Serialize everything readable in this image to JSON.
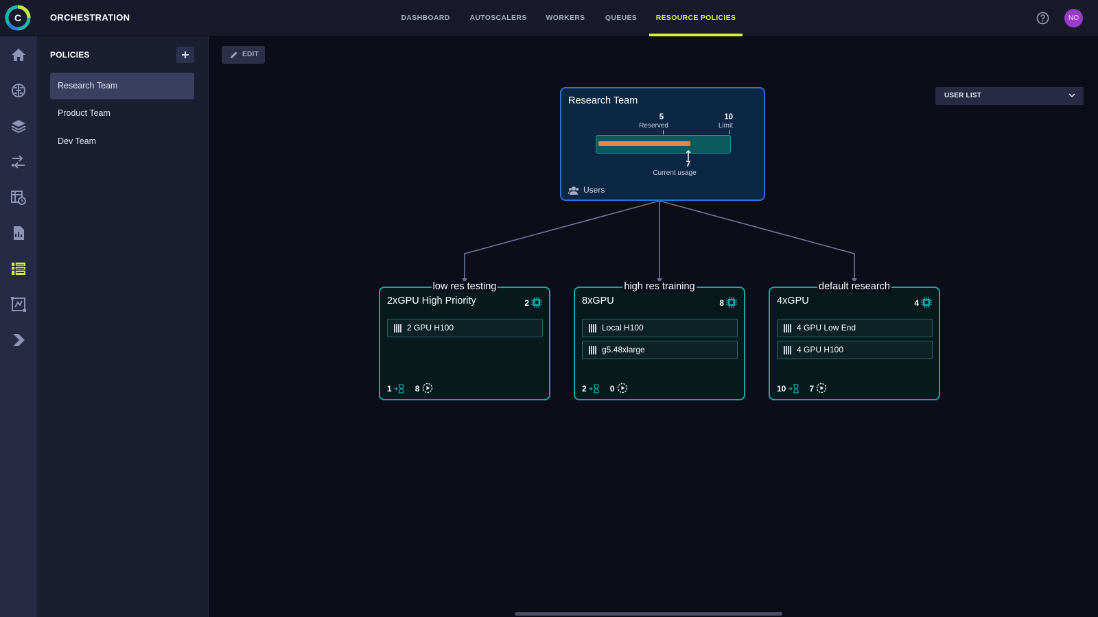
{
  "app": {
    "title": "ORCHESTRATION",
    "user_initials": "NO"
  },
  "nav": {
    "tabs": [
      {
        "label": "DASHBOARD",
        "active": false
      },
      {
        "label": "AUTOSCALERS",
        "active": false
      },
      {
        "label": "WORKERS",
        "active": false
      },
      {
        "label": "QUEUES",
        "active": false
      },
      {
        "label": "RESOURCE POLICIES",
        "active": true
      }
    ]
  },
  "rail": {
    "icons": [
      "home-icon",
      "brain-icon",
      "layers-icon",
      "pipelines-icon",
      "scheduler-icon",
      "reports-icon",
      "orchestration-icon",
      "datasets-icon",
      "deploy-icon"
    ],
    "active": "orchestration-icon"
  },
  "sidebar": {
    "title": "POLICIES",
    "items": [
      {
        "label": "Research Team",
        "selected": true
      },
      {
        "label": "Product Team",
        "selected": false
      },
      {
        "label": "Dev Team",
        "selected": false
      }
    ]
  },
  "toolbar": {
    "edit_label": "EDIT",
    "user_list_label": "USER LIST"
  },
  "root": {
    "name": "Research Team",
    "reserved_value": "5",
    "reserved_label": "Reserved",
    "limit_value": "10",
    "limit_label": "Limit",
    "current_value": "7",
    "current_label": "Current usage",
    "usage_fraction": 0.7,
    "users_label": "Users"
  },
  "children": [
    {
      "label": "low res testing",
      "name": "2xGPU High Priority",
      "gpu_count": "2",
      "resources": [
        "2 GPU H100"
      ],
      "queued": "1",
      "running": "8"
    },
    {
      "label": "high res training",
      "name": "8xGPU",
      "gpu_count": "8",
      "resources": [
        "Local H100",
        "g5.48xlarge"
      ],
      "queued": "2",
      "running": "0"
    },
    {
      "label": "default research",
      "name": "4xGPU",
      "gpu_count": "4",
      "resources": [
        "4 GPU Low End",
        "4 GPU H100"
      ],
      "queued": "10",
      "running": "7"
    }
  ],
  "colors": {
    "accent": "#d6f037",
    "root_border": "#2c74c9",
    "child_border": "#1ca5a8",
    "usage_bar": "#f2833a"
  }
}
